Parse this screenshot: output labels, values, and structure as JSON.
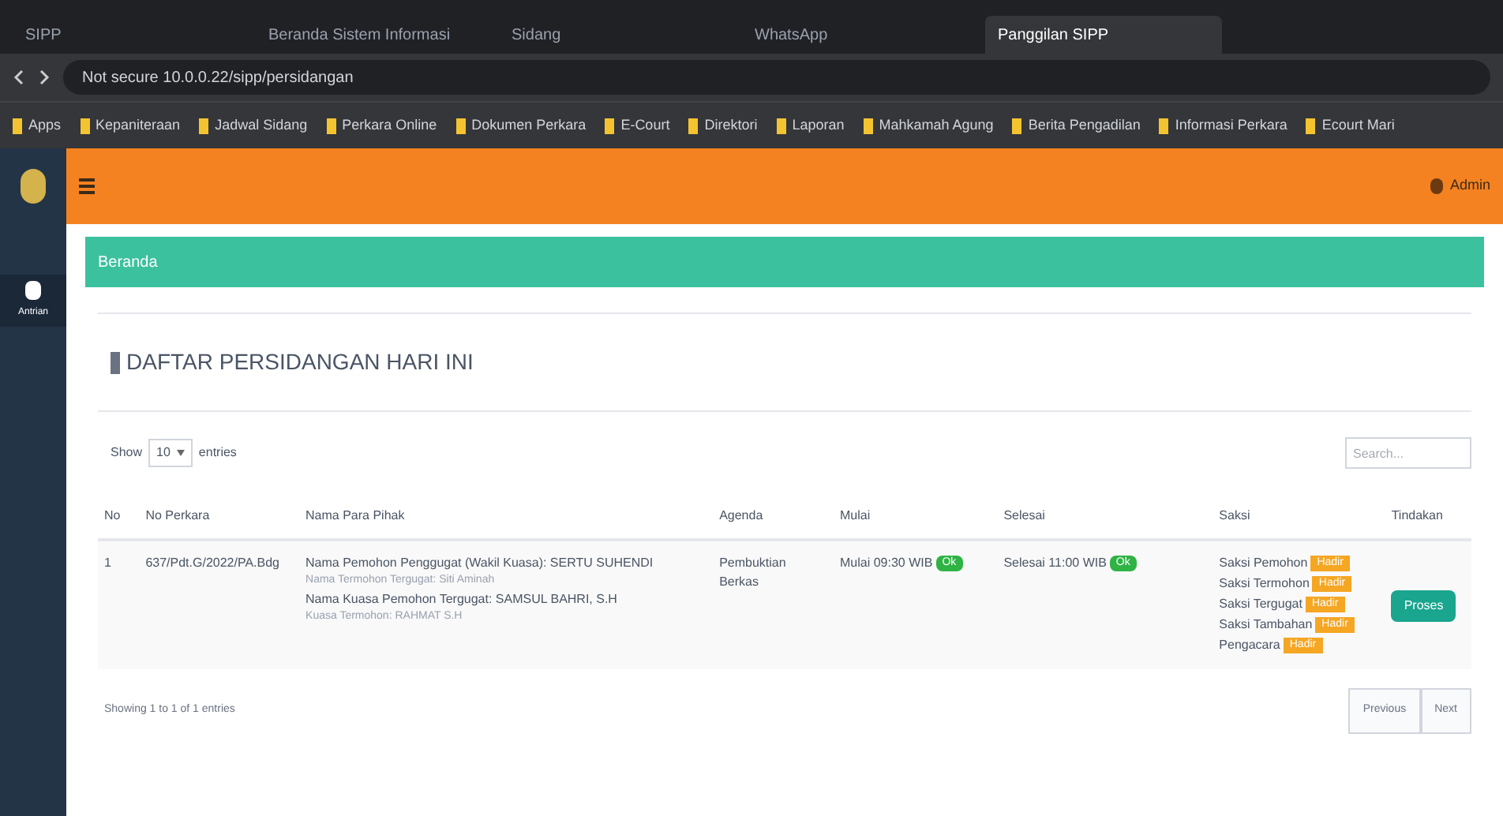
{
  "browser": {
    "tabs": [
      {
        "label": "SIPP",
        "selected": false
      },
      {
        "label": "Beranda Sistem Informasi",
        "selected": false
      },
      {
        "label": "Sidang",
        "selected": false
      },
      {
        "label": "WhatsApp",
        "selected": false
      },
      {
        "label": "Panggilan SIPP",
        "selected": true
      }
    ],
    "address": "Not secure  10.0.0.22/sipp/persidangan",
    "bookmarks": [
      "Apps",
      "Kepaniteraan",
      "Jadwal Sidang",
      "Perkara Online",
      "Dokumen Perkara",
      "E-Court",
      "Direktori",
      "Laporan",
      "Mahkamah Agung",
      "Berita Pengadilan",
      "Informasi Perkara",
      "Ecourt Mari"
    ]
  },
  "header": {
    "user": "Admin"
  },
  "sidebar": {
    "items": [
      {
        "label": "Antrian",
        "selected": true
      }
    ]
  },
  "breadcrumb": "Beranda",
  "page_title": "DAFTAR PERSIDANGAN HARI INI",
  "table_controls": {
    "show_label": "Show",
    "page_size": "10",
    "entries_label": "entries",
    "search_placeholder": "Search..."
  },
  "table": {
    "columns": [
      "No",
      "No Perkara",
      "Nama Para Pihak",
      "Agenda",
      "Mulai",
      "Selesai",
      "Saksi",
      "Tindakan"
    ],
    "rows": [
      {
        "no": "1",
        "case_number": "637/Pdt.G/2022/PA.Bdg",
        "parties": [
          "Nama Pemohon Penggugat (Wakil Kuasa): SERTU SUHENDI",
          "Nama Termohon Tergugat: Siti Aminah",
          "Nama Kuasa Pemohon Tergugat: SAMSUL BAHRI, S.H",
          "Kuasa Termohon: RAHMAT S.H"
        ],
        "agenda": "Pembuktian Berkas",
        "start": "Mulai 09:30 WIB",
        "start_badge": "Ok",
        "end": "Selesai 11:00 WIB",
        "end_badge": "Ok",
        "witnesses": [
          {
            "name": "Saksi Pemohon",
            "badge": "Hadir"
          },
          {
            "name": "Saksi Termohon",
            "badge": "Hadir"
          },
          {
            "name": "Saksi Tergugat",
            "badge": "Hadir"
          },
          {
            "name": "Saksi Tambahan",
            "badge": "Hadir"
          },
          {
            "name": "Pengacara",
            "badge": "Hadir"
          }
        ],
        "action": "Proses"
      }
    ]
  },
  "footer": {
    "info": "Showing 1 to 1 of 1 entries",
    "buttons": [
      "Previous",
      "Next"
    ]
  }
}
